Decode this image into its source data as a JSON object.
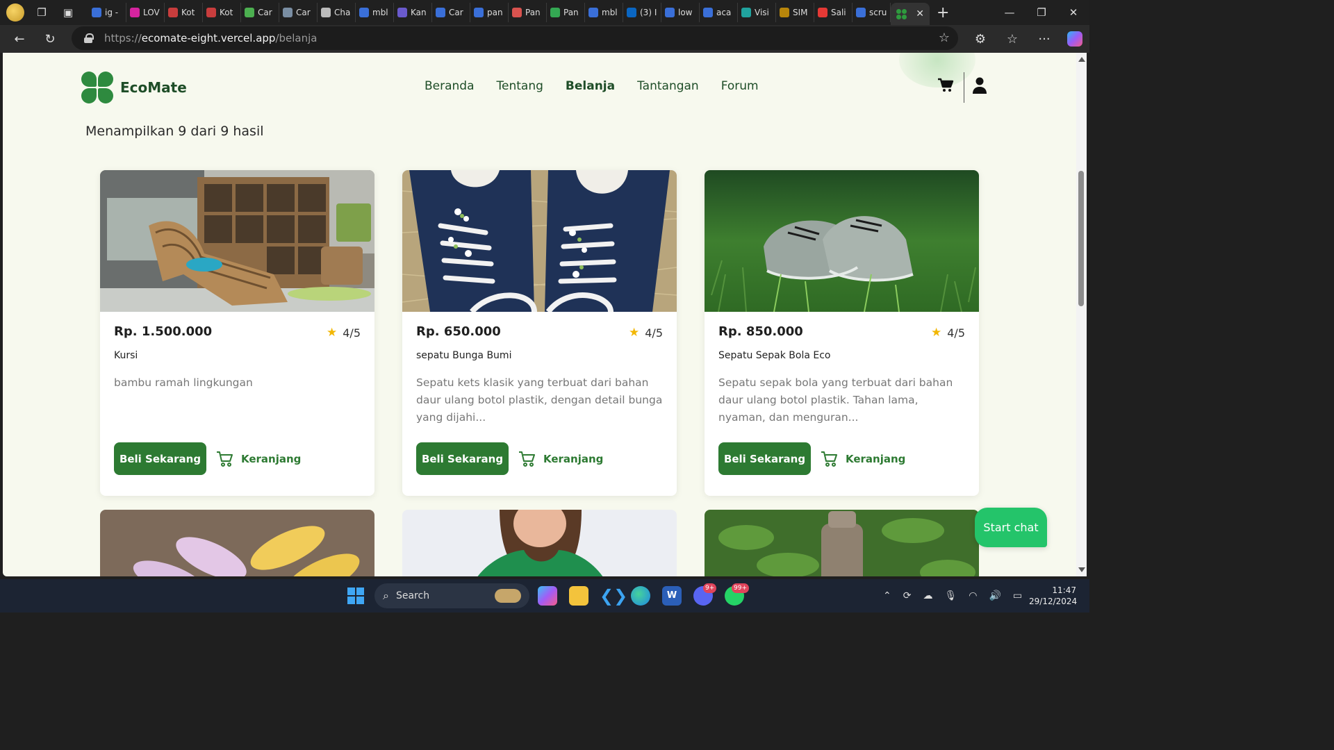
{
  "browser": {
    "tabs": [
      {
        "label": "ig -",
        "color": "#3a6fd8"
      },
      {
        "label": "LOV",
        "color": "#d6249f"
      },
      {
        "label": "Kot",
        "color": "#c83d3d"
      },
      {
        "label": "Kot",
        "color": "#c83d3d"
      },
      {
        "label": "Car",
        "color": "#4caf50"
      },
      {
        "label": "Car",
        "color": "#7a8ea3"
      },
      {
        "label": "Cha",
        "color": "#bbbbbb"
      },
      {
        "label": "mbl",
        "color": "#3a6fd8"
      },
      {
        "label": "Kan",
        "color": "#6a5acd"
      },
      {
        "label": "Car",
        "color": "#3a6fd8"
      },
      {
        "label": "pan",
        "color": "#3a6fd8"
      },
      {
        "label": "Pan",
        "color": "#d9534f"
      },
      {
        "label": "Pan",
        "color": "#34a853"
      },
      {
        "label": "mbl",
        "color": "#3a6fd8"
      },
      {
        "label": "(3) I",
        "color": "#0a66c2"
      },
      {
        "label": "low",
        "color": "#3a6fd8"
      },
      {
        "label": "aca",
        "color": "#3a6fd8"
      },
      {
        "label": "Visi",
        "color": "#20a39e"
      },
      {
        "label": "SIM",
        "color": "#b8860b"
      },
      {
        "label": "Sali",
        "color": "#e53935"
      },
      {
        "label": "scru",
        "color": "#3a6fd8"
      }
    ],
    "url_protocol": "https://",
    "url_host": "ecomate-eight.vercel.app",
    "url_path": "/belanja"
  },
  "site": {
    "brand": "EcoMate",
    "nav": [
      "Beranda",
      "Tentang",
      "Belanja",
      "Tantangan",
      "Forum"
    ],
    "active_nav": "Belanja",
    "result_text": "Menampilkan 9 dari 9 hasil",
    "buy_label": "Beli Sekarang",
    "cart_label": "Keranjang",
    "chat_label": "Start chat",
    "accent": "#2d7a32"
  },
  "products": [
    {
      "price": "Rp. 1.500.000",
      "rating": "4/5",
      "name": "Kursi",
      "desc": "bambu ramah lingkungan"
    },
    {
      "price": "Rp. 650.000",
      "rating": "4/5",
      "name": "sepatu Bunga Bumi",
      "desc": "Sepatu kets klasik yang terbuat dari bahan daur ulang botol plastik, dengan detail bunga yang dijahi..."
    },
    {
      "price": "Rp. 850.000",
      "rating": "4/5",
      "name": "Sepatu Sepak Bola Eco",
      "desc": "Sepatu sepak bola yang terbuat dari bahan daur ulang botol plastik. Tahan lama, nyaman, dan menguran..."
    }
  ],
  "taskbar": {
    "search_label": "Search",
    "discord_badge": "9+",
    "whatsapp_badge": "99+",
    "time": "11:47",
    "date": "29/12/2024"
  }
}
